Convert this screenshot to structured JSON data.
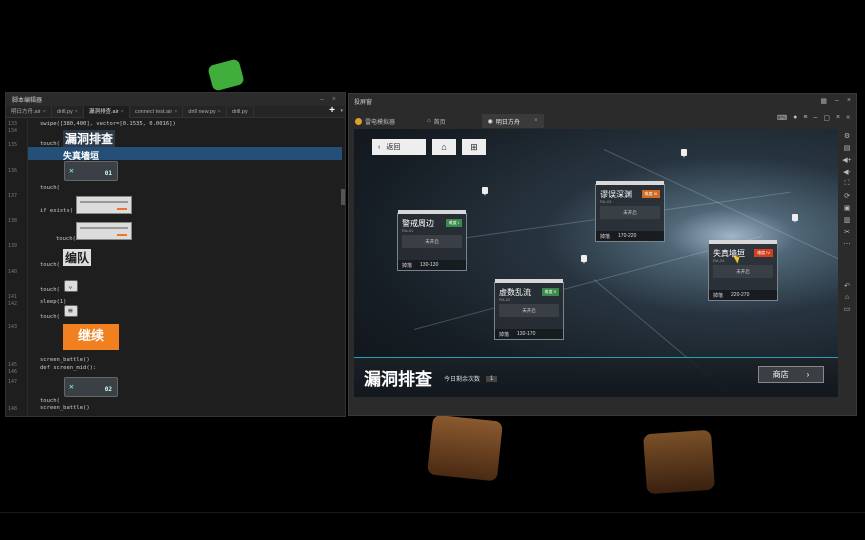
{
  "editor": {
    "title": "脚本编辑器",
    "add": "+",
    "tabs": [
      {
        "label": "明日方舟.air",
        "active": false
      },
      {
        "label": "drill.py",
        "active": false
      },
      {
        "label": "漏洞排查.air",
        "active": true
      },
      {
        "label": "connect test.air",
        "active": false
      },
      {
        "label": "drill new.py",
        "active": false
      },
      {
        "label": "drill.py",
        "active": false
      }
    ],
    "lines": [
      {
        "n": "133",
        "code": "swipe([380,400], vector=[0.1535, 0.0016])"
      },
      {
        "n": "134",
        "code": ""
      },
      {
        "n": "135",
        "code": "touch("
      },
      {
        "n": "136",
        "code": ""
      },
      {
        "n": "137",
        "code": "touch("
      },
      {
        "n": "138",
        "code": "if exists("
      },
      {
        "n": "139",
        "code": "touch("
      },
      {
        "n": "140",
        "code": "touch("
      },
      {
        "n": "141",
        "code": "touch("
      },
      {
        "n": "142",
        "code": "sleep(1)"
      },
      {
        "n": "143",
        "code": "touch("
      },
      {
        "n": "145",
        "code": "screen_battle()"
      },
      {
        "n": "146",
        "code": "def screen_mid():"
      },
      {
        "n": "147",
        "code": "touch("
      },
      {
        "n": "148",
        "code": "screen_battle()"
      }
    ],
    "img_labels": {
      "loophole": "漏洞排查",
      "distortion": "失真墙垣",
      "team": "编队",
      "continue": "继续",
      "chip1": "01",
      "chip2": "02"
    }
  },
  "emulator": {
    "title": "投屏窗",
    "tabs": [
      {
        "label": "雷电模拟器",
        "active": false
      },
      {
        "label": "首页",
        "active": false
      },
      {
        "label": "明日方舟",
        "active": true
      }
    ],
    "side_icons": [
      "settings-icon",
      "keyboard-icon",
      "volume-up-icon",
      "volume-down-icon",
      "fullscreen-icon",
      "rotate-icon",
      "screenshot-icon",
      "apk-icon",
      "scissors-icon",
      "more-icon",
      "back-icon",
      "home-icon",
      "recent-icon"
    ]
  },
  "game": {
    "back_label": "返回",
    "nodes": [
      {
        "name": "警戒周边",
        "code": "RA-01",
        "tag": "难度 I",
        "tag_color": "#3a8a4a",
        "mid": "未开启",
        "drop": "掉落",
        "range": "130-130"
      },
      {
        "name": "谬误深渊",
        "code": "RA-03",
        "tag": "难度 III",
        "tag_color": "#d06a20",
        "mid": "未开启",
        "drop": "掉落",
        "range": "170-220"
      },
      {
        "name": "虚数乱流",
        "code": "RA-02",
        "tag": "难度 II",
        "tag_color": "#3a8a4a",
        "mid": "未开启",
        "drop": "掉落",
        "range": "130-170"
      },
      {
        "name": "失真墙垣",
        "code": "RA-04",
        "tag": "难度 IV",
        "tag_color": "#d04020",
        "mid": "未开启",
        "drop": "掉落",
        "range": "220-270"
      }
    ],
    "title": "漏洞排查",
    "remain_label": "今日剩余次数",
    "remain_count": "1",
    "shop_label": "商店",
    "shop_arrow": "›"
  }
}
